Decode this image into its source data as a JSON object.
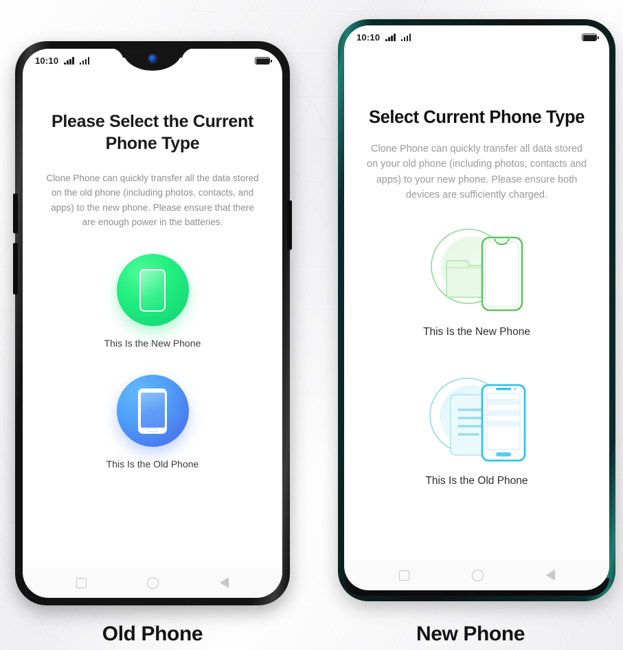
{
  "background": {
    "style": "hexagonal-light-gray-pattern",
    "base_color": "#f4f4f4"
  },
  "captions": {
    "left": "Old Phone",
    "right": "New Phone"
  },
  "phone_old": {
    "frame_color": "#121212",
    "statusbar": {
      "time": "10:10",
      "signal_icon_1": "signal-bars-icon",
      "signal_icon_2": "signal-bars-icon",
      "battery_icon": "battery-full-icon"
    },
    "title": "Please Select the Current Phone Type",
    "description": "Clone Phone can quickly transfer all the data stored on the old phone (including photos, contacts, and apps) to the new phone. Please ensure that there are enough power in the batteries.",
    "options": [
      {
        "label": "This Is the New Phone",
        "icon": "new-phone-circle-icon",
        "color": "#1ae178"
      },
      {
        "label": "This Is the Old Phone",
        "icon": "old-phone-circle-icon",
        "color": "#4a7cf0"
      }
    ],
    "navbar": {
      "recents": "square-icon",
      "home": "circle-icon",
      "back": "triangle-back-icon"
    }
  },
  "phone_new": {
    "frame_color": "#0a2b2c",
    "accent_edge_color": "#1d7d72",
    "statusbar": {
      "time": "10:10",
      "signal_icon_1": "signal-bars-icon",
      "signal_icon_2": "signal-bars-icon",
      "battery_icon": "battery-full-icon"
    },
    "title": "Select Current Phone Type",
    "description": "Clone Phone can quickly transfer all data stored on your old phone (including photos, contacts and apps) to your new phone. Please ensure both devices are sufficiently charged.",
    "options": [
      {
        "label": "This Is the New Phone",
        "icon": "new-phone-lineart-icon",
        "color": "#5cc563"
      },
      {
        "label": "This Is the Old Phone",
        "icon": "old-phone-lineart-icon",
        "color": "#33c3e8"
      }
    ],
    "navbar": {
      "recents": "square-icon",
      "home": "circle-icon",
      "back": "triangle-back-icon"
    }
  }
}
